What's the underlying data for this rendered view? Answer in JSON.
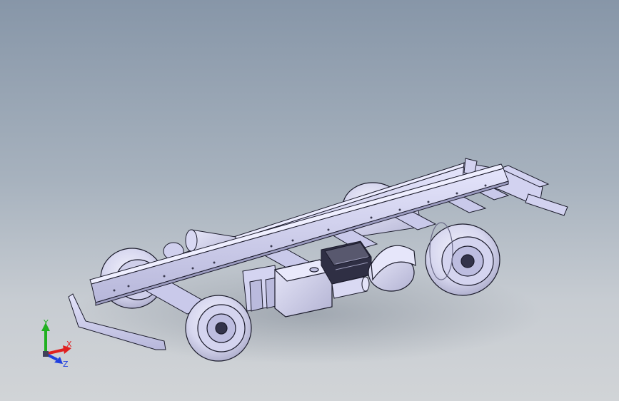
{
  "view": {
    "background_top": "#8796a8",
    "background_bottom": "#d1d4d7",
    "model_fill": "#d6d6f5",
    "model_edge": "#1a1a2a",
    "tire_fill": "#dcdcf0"
  },
  "triad": {
    "x_label": "X",
    "y_label": "Y",
    "z_label": "Z",
    "x_color": "#e02020",
    "y_color": "#20b020",
    "z_color": "#2040e0"
  }
}
